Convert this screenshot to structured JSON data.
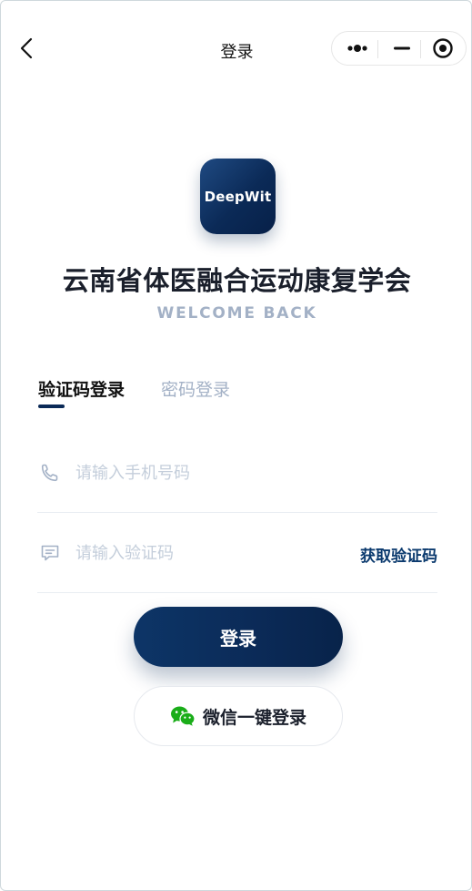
{
  "nav": {
    "title": "登录"
  },
  "logo": {
    "text": "DeepWit"
  },
  "header": {
    "org_name": "云南省体医融合运动康复学会",
    "welcome": "WELCOME BACK"
  },
  "tabs": [
    {
      "label": "验证码登录",
      "active": true
    },
    {
      "label": "密码登录",
      "active": false
    }
  ],
  "form": {
    "phone_placeholder": "请输入手机号码",
    "phone_value": "",
    "code_placeholder": "请输入验证码",
    "code_value": "",
    "get_code_label": "获取验证码"
  },
  "buttons": {
    "login_label": "登录",
    "wechat_label": "微信一键登录"
  },
  "colors": {
    "brand_navy": "#0b2a57",
    "placeholder": "#c4cedb",
    "wechat_green": "#1aad19"
  },
  "icons": {
    "back": "chevron-left-icon",
    "more": "more-dots-icon",
    "minimize": "minimize-icon",
    "close": "target-close-icon",
    "phone": "phone-icon",
    "message": "message-icon",
    "wechat": "wechat-icon"
  }
}
